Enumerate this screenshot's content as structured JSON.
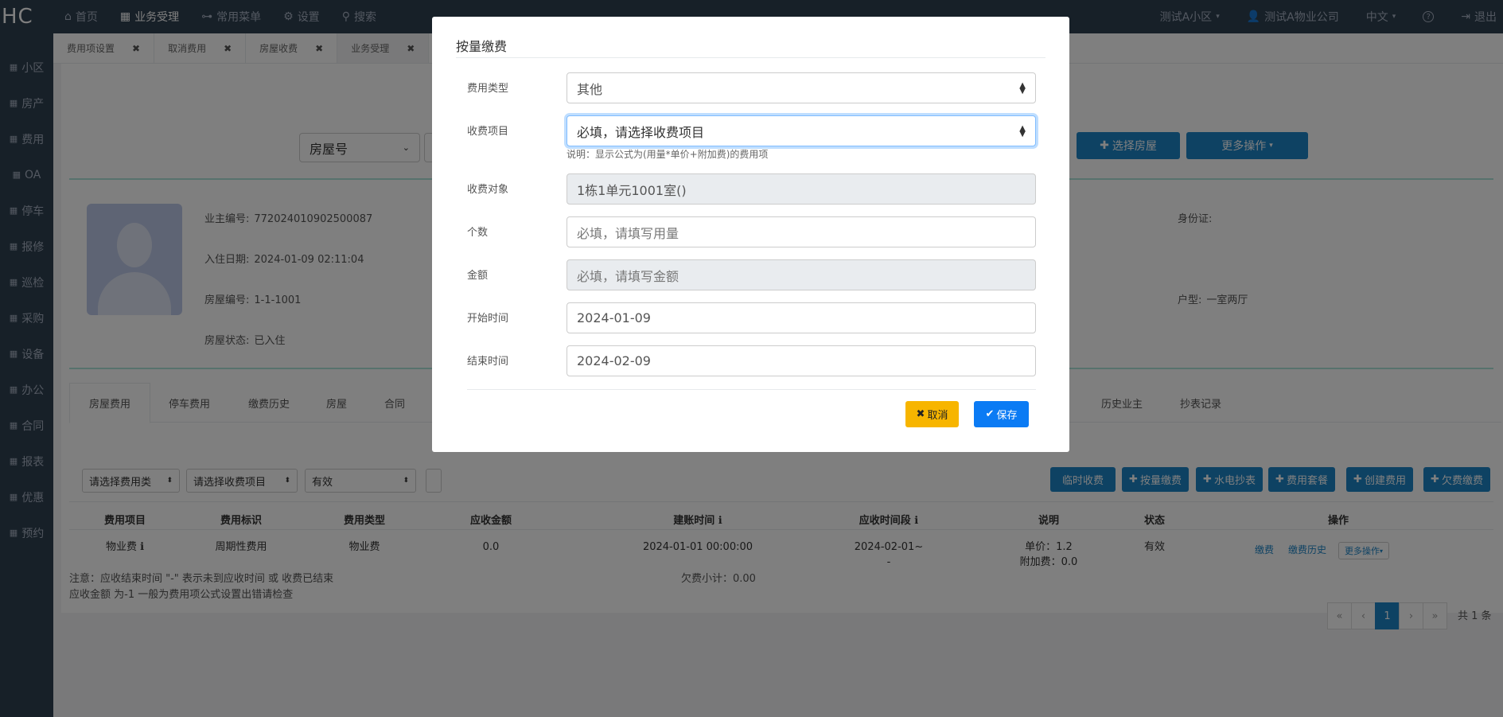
{
  "topbar": {
    "logo": "HC",
    "nav": [
      {
        "icon": "home-icon",
        "glyph": "⌂",
        "label": "首页"
      },
      {
        "icon": "calculator-icon",
        "glyph": "▦",
        "label": "业务受理"
      },
      {
        "icon": "sitemap-icon",
        "glyph": "⊶",
        "label": "常用菜单"
      },
      {
        "icon": "gear-icon",
        "glyph": "⚙",
        "label": "设置"
      },
      {
        "icon": "search-icon",
        "glyph": "⚲",
        "label": "搜索"
      }
    ],
    "community": "测试A小区",
    "user": "测试A物业公司",
    "language": "中文",
    "help_glyph": "?",
    "logout": "退出"
  },
  "sidebar": {
    "items": [
      "小区",
      "房产",
      "费用",
      "OA",
      "停车",
      "报修",
      "巡检",
      "采购",
      "设备",
      "办公",
      "合同",
      "报表",
      "优惠",
      "预约"
    ]
  },
  "tabs": [
    {
      "label": "费用项设置"
    },
    {
      "label": "取消费用"
    },
    {
      "label": "房屋收费"
    },
    {
      "label": "业务受理"
    }
  ],
  "search": {
    "type_select": "房屋号",
    "select_room_button": "选择房屋",
    "more_button": "更多操作"
  },
  "owner": {
    "code_label": "业主编号:",
    "code": "772024010902500087",
    "checkin_label": "入住日期:",
    "checkin": "2024-01-09 02:11:04",
    "room_label": "房屋编号:",
    "room": "1-1-1001",
    "status_label": "房屋状态:",
    "status": "已入住",
    "id_label": "身份证:",
    "id": "",
    "layout_label": "户型:",
    "layout": "一室两厅"
  },
  "subtabs": [
    "房屋费用",
    "停车费用",
    "缴费历史",
    "房屋",
    "合同",
    "历史业主",
    "抄表记录"
  ],
  "filters": {
    "fee_type": "请选择费用类",
    "fee_item": "请选择收费项目",
    "state": "有效"
  },
  "actions": [
    "临时收费",
    "按量缴费",
    "水电抄表",
    "费用套餐",
    "创建费用",
    "欠费缴费"
  ],
  "table": {
    "headers": [
      "费用项目",
      "费用标识",
      "费用类型",
      "应收金额",
      "建账时间",
      "应收时间段",
      "说明",
      "状态",
      "操作"
    ],
    "rows": [
      {
        "item": "物业费",
        "flag": "周期性费用",
        "type": "物业费",
        "amount": "0.0",
        "created": "2024-01-01 00:00:00",
        "period_line1": "2024-02-01~",
        "period_line2": "-",
        "desc_line1": "单价：1.2",
        "desc_line2": "附加费：0.0",
        "status": "有效",
        "op_pay": "缴费",
        "op_history": "缴费历史",
        "op_more": "更多操作"
      }
    ]
  },
  "notes": {
    "line1": "注意：应收结束时间 \"-\" 表示未到应收时间 或 收费已结束",
    "line2": "应收金额 为-1 一般为费用项公式设置出错请检查",
    "arrears": "欠费小计：0.00"
  },
  "pagination": {
    "first": "«",
    "prev": "‹",
    "current": "1",
    "next": "›",
    "last": "»",
    "total": "共 1 条"
  },
  "modal": {
    "title": "按量缴费",
    "fee_type_label": "费用类型",
    "fee_type_value": "其他",
    "fee_item_label": "收费项目",
    "fee_item_value": "必填，请选择收费项目",
    "hint": "说明：显示公式为(用量*单价+附加费)的费用项",
    "target_label": "收费对象",
    "target_value": "1栋1单元1001室()",
    "count_label": "个数",
    "count_placeholder": "必填，请填写用量",
    "amount_label": "金额",
    "amount_placeholder": "必填，请填写金额",
    "start_label": "开始时间",
    "start_value": "2024-01-09",
    "end_label": "结束时间",
    "end_value": "2024-02-09",
    "cancel": "取消",
    "save": "保存"
  }
}
